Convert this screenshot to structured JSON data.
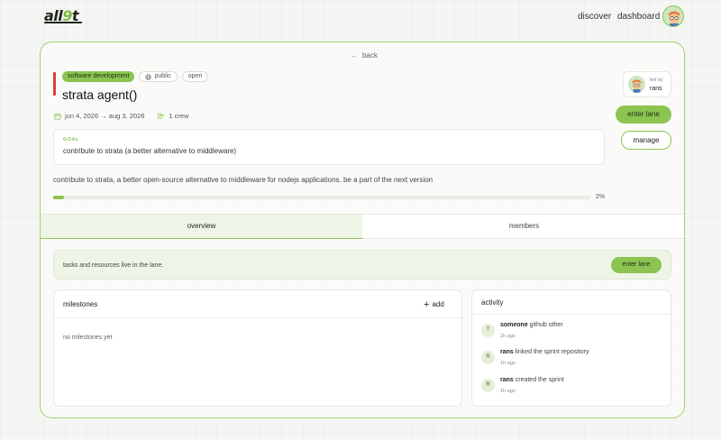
{
  "nav": {
    "logo_prefix": "all",
    "logo_accent": "9",
    "logo_suffix": "t",
    "discover": "discover",
    "dashboard": "dashboard"
  },
  "page": {
    "back": "back",
    "tags": {
      "category": "software development",
      "visibility": "public",
      "status": "open"
    },
    "title": "strata agent()",
    "dates": "jun 4, 2026 → aug 3, 2026",
    "crew": "1 crew",
    "goal_label": "GOAL",
    "goal_text": "contribute to strata (a better alternative to middleware)",
    "description": "contribute to strata, a better open-source alternative to middleware for nodejs applications. be a part of the next version",
    "progress_percent": 2,
    "progress_label": "2%",
    "led_by_label": "led by",
    "leader": "rans",
    "enter_lane": "enter lane",
    "manage": "manage"
  },
  "tabs": {
    "overview": "overview",
    "members": "members"
  },
  "lane_banner": {
    "text": "tasks and resources live in the lane.",
    "button": "enter lane"
  },
  "milestones": {
    "title": "milestones",
    "add": "add",
    "empty": "no milestones yet"
  },
  "activity": {
    "title": "activity",
    "items": [
      {
        "initial": "T",
        "actor": "someone",
        "text": " github other",
        "time": "1h ago"
      },
      {
        "initial": "R",
        "actor": "rans",
        "text": " linked the sprint repository",
        "time": "1h ago"
      },
      {
        "initial": "R",
        "actor": "rans",
        "text": " created the sprint",
        "time": "1h ago"
      }
    ]
  },
  "colors": {
    "accent": "#8cc452",
    "danger_bar": "#d9423a",
    "border": "#9bd36a"
  },
  "icons": {
    "back": "arrow-left-icon",
    "public": "globe-icon",
    "calendar": "calendar-icon",
    "crew": "users-icon",
    "add": "plus-icon"
  }
}
